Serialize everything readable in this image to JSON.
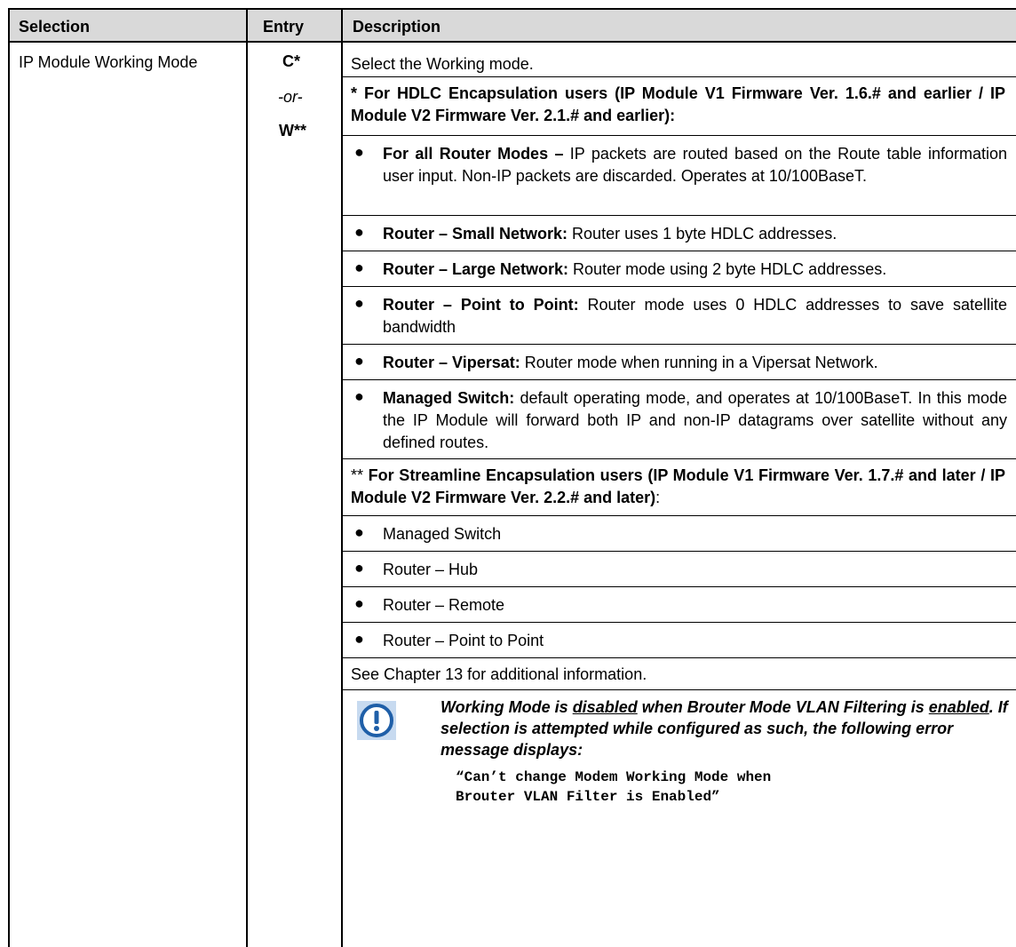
{
  "headers": {
    "selection": "Selection",
    "entry": "Entry",
    "description": "Description"
  },
  "selection": "IP Module Working Mode",
  "entry": {
    "c": "C*",
    "or": "-or-",
    "w": "W**"
  },
  "desc": {
    "intro": "Select the Working mode.",
    "hdlc_heading": "* For HDLC Encapsulation users (IP Module V1 Firmware Ver. 1.6.# and earlier / IP Module V2 Firmware Ver. 2.1.# and earlier):",
    "hdlc_bullets": [
      {
        "bold": "For all Router Modes –",
        "text": " IP packets are routed based on the Route table information user input. Non-IP packets are discarded. Operates at 10/100BaseT."
      },
      {
        "bold": "Router – Small Network:",
        "text": " Router uses 1 byte HDLC addresses."
      },
      {
        "bold": "Router – Large Network:",
        "text": "  Router mode using 2 byte HDLC addresses."
      },
      {
        "bold": "Router – Point to Point:",
        "text": " Router mode uses 0 HDLC addresses to save satellite bandwidth"
      },
      {
        "bold": "Router – Vipersat:",
        "text": " Router mode when running in a Vipersat Network."
      },
      {
        "bold": "Managed Switch:",
        "text": " default operating mode, and operates at 10/100BaseT. In this mode the IP Module will forward both IP and non-IP datagrams over satellite without any defined routes."
      }
    ],
    "stream_heading_pre": "**",
    "stream_heading": " For Streamline Encapsulation users (IP Module V1 Firmware Ver. 1.7.# and later / IP Module V2 Firmware Ver. 2.2.# and later)",
    "stream_heading_post": ":",
    "stream_bullets": [
      "Managed Switch",
      "Router – Hub",
      "Router – Remote",
      "Router – Point to Point"
    ],
    "see_chapter": "See Chapter 13 for additional information.",
    "note": {
      "p1": "Working Mode is ",
      "u1": "disabled",
      "p2": " when Brouter Mode VLAN Filtering is ",
      "u2": "enabled",
      "p3": ". If selection is attempted while configured as such, the following error message displays:",
      "code1": "“Can’t change Modem Working Mode when",
      "code2": "Brouter VLAN Filter is Enabled”"
    }
  },
  "colors": {
    "header_bg": "#d9d9d9",
    "icon_blue": "#1f5fa8",
    "icon_light": "#c7daf0"
  }
}
